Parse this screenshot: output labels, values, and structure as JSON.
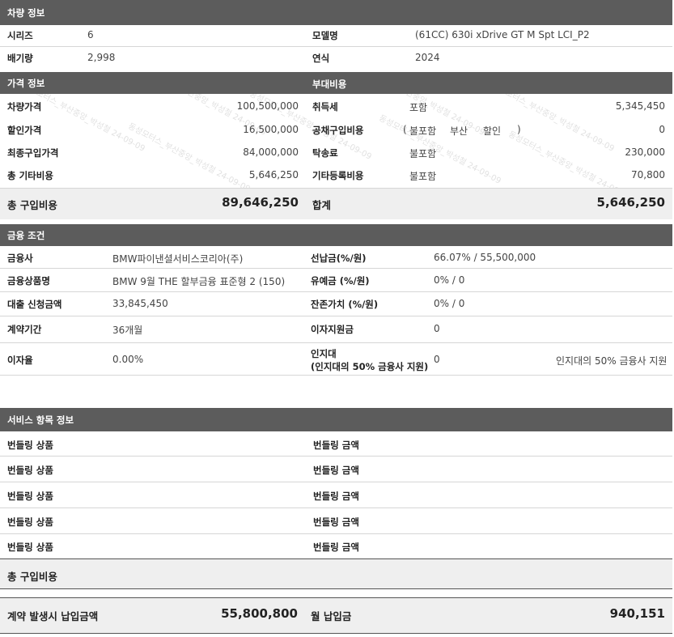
{
  "vehicle": {
    "header": "차량 정보",
    "series_label": "시리즈",
    "series_value": "6",
    "model_label": "모델명",
    "model_value": "(61CC) 630i xDrive GT M Spt LCI_P2",
    "displacement_label": "배기량",
    "displacement_value": "2,998",
    "year_label": "연식",
    "year_value": "2024"
  },
  "price": {
    "header": "가격 정보",
    "vehicle_price_label": "차량가격",
    "vehicle_price_value": "100,500,000",
    "discount_label": "할인가격",
    "discount_value": "16,500,000",
    "final_price_label": "최종구입가격",
    "final_price_value": "84,000,000",
    "other_cost_label": "총 기타비용",
    "other_cost_value": "5,646,250",
    "total_label": "총 구입비용",
    "total_value": "89,646,250"
  },
  "extra": {
    "header": "부대비용",
    "acquisition_label": "취득세",
    "acquisition_option": "포함",
    "acquisition_value": "5,345,450",
    "bond_label": "공채구입비용",
    "bond_open": "(",
    "bond_opt1": "불포함",
    "bond_opt2": "부산",
    "bond_opt3": "할인",
    "bond_close": ")",
    "bond_value": "0",
    "delivery_label": "탁송료",
    "delivery_option": "불포함",
    "delivery_value": "230,000",
    "registration_label": "기타등록비용",
    "registration_option": "불포함",
    "registration_value": "70,800",
    "sum_label": "합계",
    "sum_value": "5,646,250"
  },
  "finance": {
    "header": "금융 조건",
    "company_label": "금융사",
    "company_value": "BMW파이낸셜서비스코리아(주)",
    "product_label": "금융상품명",
    "product_value": "BMW 9월 THE 할부금융 표준형 2 (150)",
    "loan_label": "대출 신청금액",
    "loan_value": "33,845,450",
    "term_label": "계약기간",
    "term_value": "36개월",
    "rate_label": "이자율",
    "rate_value": "0.00%",
    "prepay_label": "선납금(%/원)",
    "prepay_value": "66.07% / 55,500,000",
    "deposit_label": "유예금 (%/원)",
    "deposit_value": "0% / 0",
    "residual_label": "잔존가치 (%/원)",
    "residual_value": "0% / 0",
    "interest_support_label": "이자지원금",
    "interest_support_value": "0",
    "incentive_label_1": "인지대",
    "incentive_label_2": "(인지대의 50% 금융사 지원)",
    "incentive_value": "0",
    "incentive_note": "인지대의 50% 금융사 지원"
  },
  "service": {
    "header": "서비스 항목 정보",
    "rows": [
      {
        "product_label": "번들링 상품",
        "amount_label": "번들링 금액"
      },
      {
        "product_label": "번들링 상품",
        "amount_label": "번들링 금액"
      },
      {
        "product_label": "번들링 상품",
        "amount_label": "번들링 금액"
      },
      {
        "product_label": "번들링 상품",
        "amount_label": "번들링 금액"
      },
      {
        "product_label": "번들링 상품",
        "amount_label": "번들링 금액"
      }
    ],
    "total_label": "총 구입비용"
  },
  "summary": {
    "contract_label": "계약 발생시 납입금액",
    "contract_value": "55,800,800",
    "monthly_label": "월 납입금",
    "monthly_value": "940,151"
  },
  "watermark": "동성모터스_부산중앙_박성철 24-09-09"
}
